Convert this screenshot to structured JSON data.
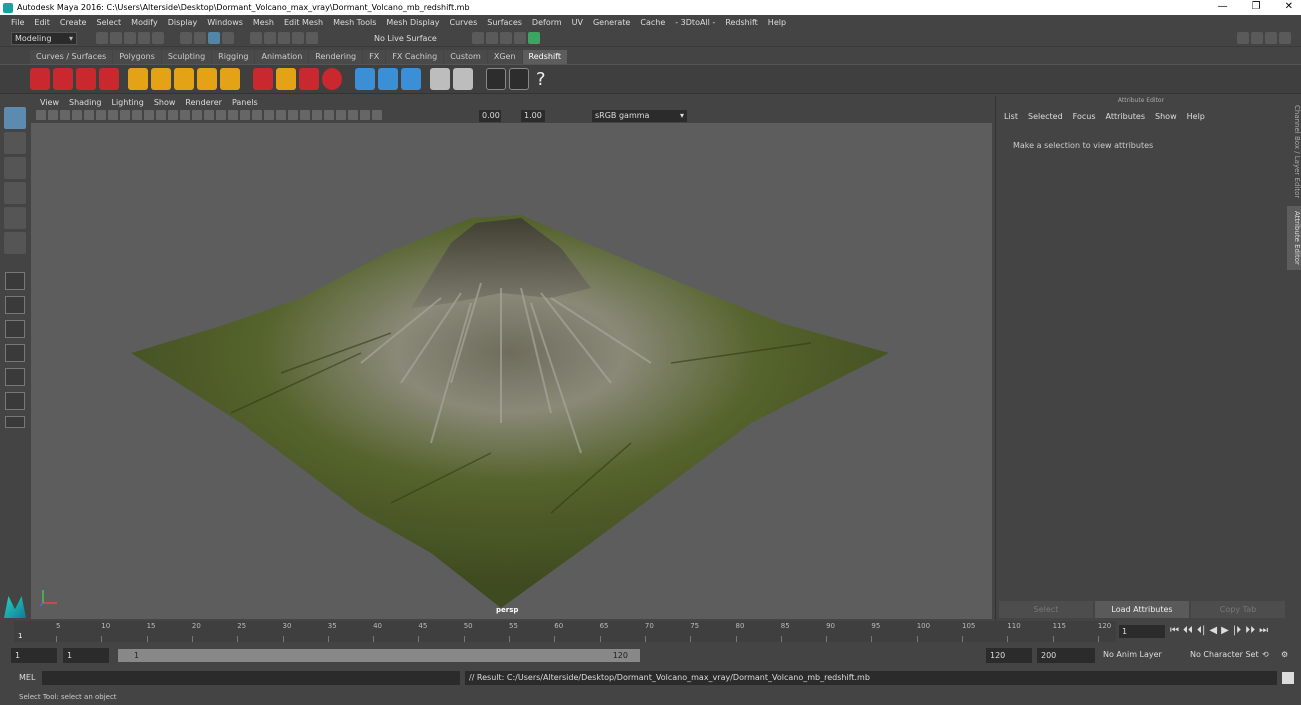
{
  "window": {
    "title": "Autodesk Maya 2016: C:\\Users\\Alterside\\Desktop\\Dormant_Volcano_max_vray\\Dormant_Volcano_mb_redshift.mb",
    "minimize": "—",
    "restore": "❐",
    "close": "✕"
  },
  "menubar": [
    "File",
    "Edit",
    "Create",
    "Select",
    "Modify",
    "Display",
    "Windows",
    "Mesh",
    "Edit Mesh",
    "Mesh Tools",
    "Mesh Display",
    "Curves",
    "Surfaces",
    "Deform",
    "UV",
    "Generate",
    "Cache",
    "- 3DtoAll -",
    "Redshift",
    "Help"
  ],
  "statusline": {
    "mode": "Modeling",
    "live_surface": "No Live Surface"
  },
  "shelf": {
    "tabs": [
      "Curves / Surfaces",
      "Polygons",
      "Sculpting",
      "Rigging",
      "Animation",
      "Rendering",
      "FX",
      "FX Caching",
      "Custom",
      "XGen",
      "Redshift"
    ],
    "active_tab": "Redshift",
    "help_icon": "?"
  },
  "viewport": {
    "menu": [
      "View",
      "Shading",
      "Lighting",
      "Show",
      "Renderer",
      "Panels"
    ],
    "exposure": "0.00",
    "gamma": "1.00",
    "color_space": "sRGB gamma",
    "camera_label": "persp"
  },
  "attribute_editor": {
    "title": "Attribute Editor",
    "menu": [
      "List",
      "Selected",
      "Focus",
      "Attributes",
      "Show",
      "Help"
    ],
    "message": "Make a selection to view attributes",
    "buttons": [
      "Select",
      "Load Attributes",
      "Copy Tab"
    ]
  },
  "side_tabs": [
    "Channel Box / Layer Editor",
    "Attribute Editor"
  ],
  "timeline": {
    "ticks": [
      "5",
      "10",
      "15",
      "20",
      "25",
      "30",
      "35",
      "40",
      "45",
      "50",
      "55",
      "60",
      "65",
      "70",
      "75",
      "80",
      "85",
      "90",
      "95",
      "100",
      "105",
      "110",
      "115",
      "120"
    ],
    "current_marker": "1",
    "current_frame": "1",
    "playback_icons": [
      "⏮",
      "⏴⏴",
      "⏴|",
      "◀",
      "▶",
      "|⏵",
      "⏵⏵",
      "⏭"
    ]
  },
  "range": {
    "start": "1",
    "playback_start": "1",
    "bar_start": "1",
    "bar_end": "120",
    "playback_end": "120",
    "end": "200",
    "anim_layer": "No Anim Layer",
    "character_set": "No Character Set"
  },
  "command": {
    "label": "MEL",
    "result": "// Result: C:/Users/Alterside/Desktop/Dormant_Volcano_max_vray/Dormant_Volcano_mb_redshift.mb"
  },
  "helpline": "Select Tool: select an object",
  "colors": {
    "accent": "#5285a6",
    "shelf_red": "#c8282e",
    "shelf_yellow": "#e4a317",
    "terrain_green": "#4e5a2a"
  }
}
